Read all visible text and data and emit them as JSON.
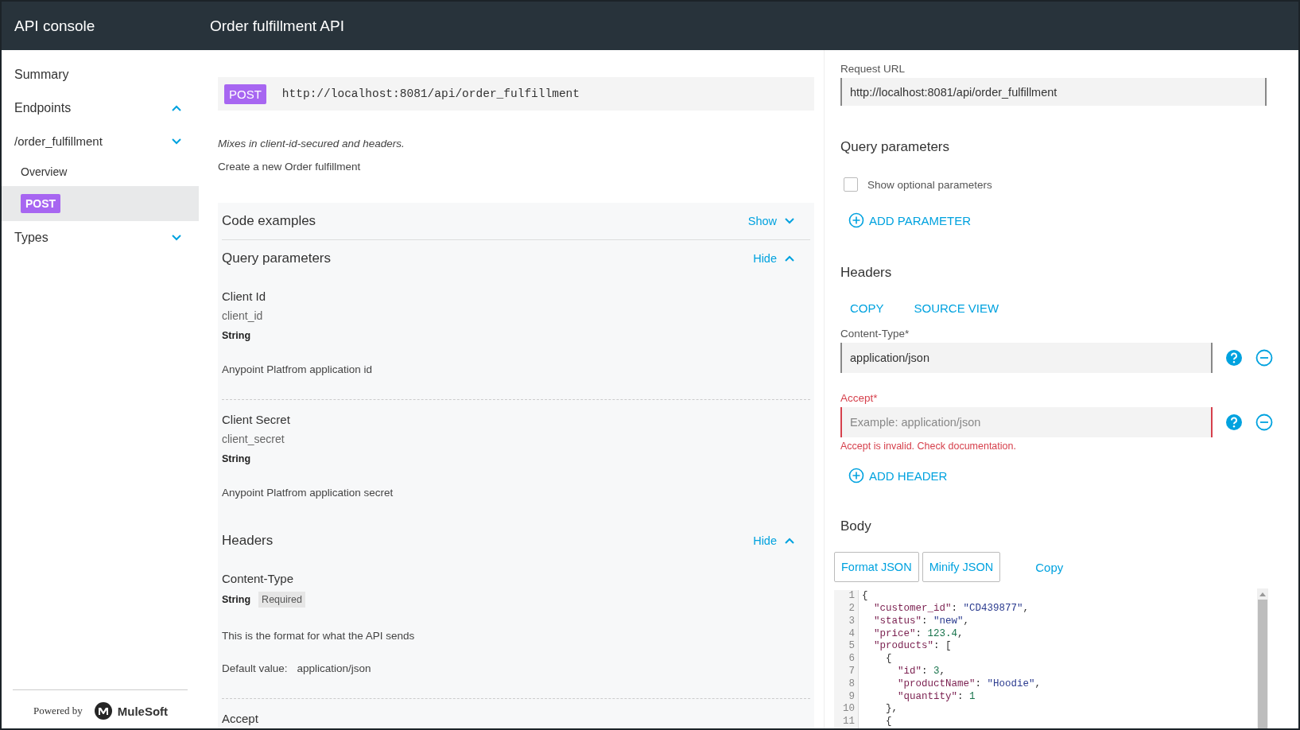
{
  "app_bar": {
    "title": "API console",
    "page_title": "Order fulfillment API"
  },
  "sidebar": {
    "items": [
      {
        "label": "Summary",
        "kind": "link",
        "selected": false
      },
      {
        "label": "Endpoints",
        "kind": "group",
        "expanded": true,
        "children": [
          {
            "label": "/order_fulfillment",
            "kind": "group",
            "expanded": false,
            "children": [
              {
                "label": "Overview",
                "kind": "link",
                "selected": false
              },
              {
                "label": "POST",
                "kind": "method",
                "selected": true
              }
            ]
          }
        ]
      },
      {
        "label": "Types",
        "kind": "group",
        "expanded": false
      }
    ],
    "footer": {
      "powered_by": "Powered by",
      "brand": "MuleSoft"
    }
  },
  "endpoint": {
    "method": "POST",
    "url": "http://localhost:8081/api/order_fulfillment",
    "mixins_note": "Mixes in client-id-secured and headers.",
    "description": "Create a new Order fulfillment"
  },
  "sections": [
    {
      "title": "Code examples",
      "toggle": "Show",
      "expanded": false
    },
    {
      "title": "Query parameters",
      "toggle": "Hide",
      "expanded": true,
      "params": [
        {
          "name": "Client Id",
          "key": "client_id",
          "type": "String",
          "description": "Anypoint Platfrom application id"
        },
        {
          "name": "Client Secret",
          "key": "client_secret",
          "type": "String",
          "description": "Anypoint Platfrom application secret"
        }
      ]
    },
    {
      "title": "Headers",
      "toggle": "Hide",
      "expanded": true,
      "params": [
        {
          "name": "Content-Type",
          "type": "String",
          "badge": "Required",
          "description": "This is the format for what the API sends",
          "default_label": "Default value:",
          "default_value": "application/json"
        },
        {
          "name": "Accept"
        }
      ]
    }
  ],
  "request_panel": {
    "url_label": "Request URL",
    "url_value": "http://localhost:8081/api/order_fulfillment",
    "query_parameters": {
      "title": "Query parameters",
      "optional_label": "Show optional parameters",
      "checked": false,
      "add_label": "ADD PARAMETER"
    },
    "headers": {
      "title": "Headers",
      "actions": [
        "COPY",
        "SOURCE VIEW"
      ],
      "fields": [
        {
          "label": "Content-Type*",
          "value": "application/json",
          "invalid": false
        },
        {
          "label": "Accept*",
          "placeholder": "Example: application/json",
          "invalid": true,
          "error": "Accept is invalid. Check documentation."
        }
      ],
      "add_label": "ADD HEADER"
    },
    "body": {
      "title": "Body",
      "buttons": [
        {
          "label": "Format JSON",
          "kind": "outlined"
        },
        {
          "label": "Minify JSON",
          "kind": "outlined"
        },
        {
          "label": "Copy",
          "kind": "text"
        }
      ],
      "lines": [
        {
          "number": "1",
          "text": "{"
        },
        {
          "number": "2",
          "text": "  \"customer_id\": \"CD439877\","
        },
        {
          "number": "3",
          "text": "  \"status\": \"new\","
        },
        {
          "number": "4",
          "text": "  \"price\": 123.4,"
        },
        {
          "number": "5",
          "text": "  \"products\": ["
        },
        {
          "number": "6",
          "text": "    {"
        },
        {
          "number": "7",
          "text": "      \"id\": 3,"
        },
        {
          "number": "8",
          "text": "      \"productName\": \"Hoodie\","
        },
        {
          "number": "9",
          "text": "      \"quantity\": 1"
        },
        {
          "number": "10",
          "text": "    },"
        },
        {
          "number": "11",
          "text": "    {"
        }
      ]
    }
  }
}
